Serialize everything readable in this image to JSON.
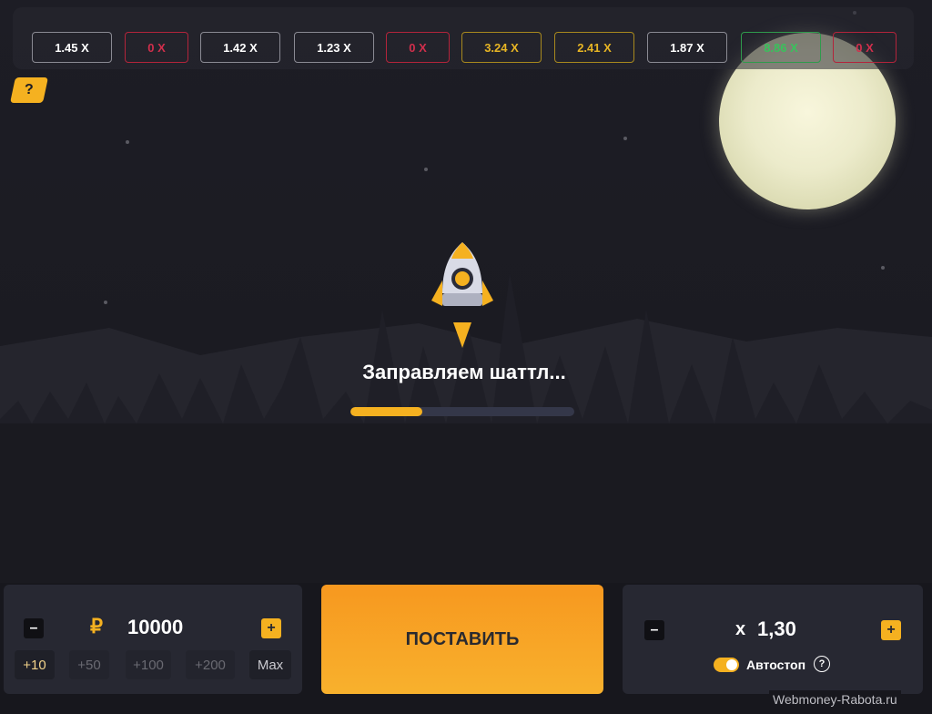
{
  "history": [
    {
      "label": "1.45 X",
      "state": "normal"
    },
    {
      "label": "0 X",
      "state": "zero"
    },
    {
      "label": "1.42 X",
      "state": "normal"
    },
    {
      "label": "1.23 X",
      "state": "normal"
    },
    {
      "label": "0 X",
      "state": "zero"
    },
    {
      "label": "3.24 X",
      "state": "gold"
    },
    {
      "label": "2.41 X",
      "state": "gold"
    },
    {
      "label": "1.87 X",
      "state": "normal"
    },
    {
      "label": "8.86 X",
      "state": "green"
    },
    {
      "label": "0 X",
      "state": "zero"
    }
  ],
  "help_label": "?",
  "loader": {
    "title": "Заправляем шаттл...",
    "progress_percent": 32
  },
  "bet": {
    "minus_label": "–",
    "plus_label": "+",
    "currency_symbol": "₽",
    "amount": "10000",
    "quick_amounts": [
      "+10",
      "+50",
      "+100",
      "+200",
      "Max"
    ]
  },
  "place_button_label": "ПОСТАВИТЬ",
  "autostop": {
    "minus_label": "–",
    "plus_label": "+",
    "prefix": "x",
    "coefficient": "1,30",
    "label": "Автостоп",
    "help": "?",
    "enabled": true
  },
  "watermark": "Webmoney-Rabota.ru",
  "colors": {
    "accent": "#f5b120",
    "zero": "#d22f4c",
    "gold": "#e7b524",
    "green": "#39c25c",
    "background": "#17171d"
  }
}
